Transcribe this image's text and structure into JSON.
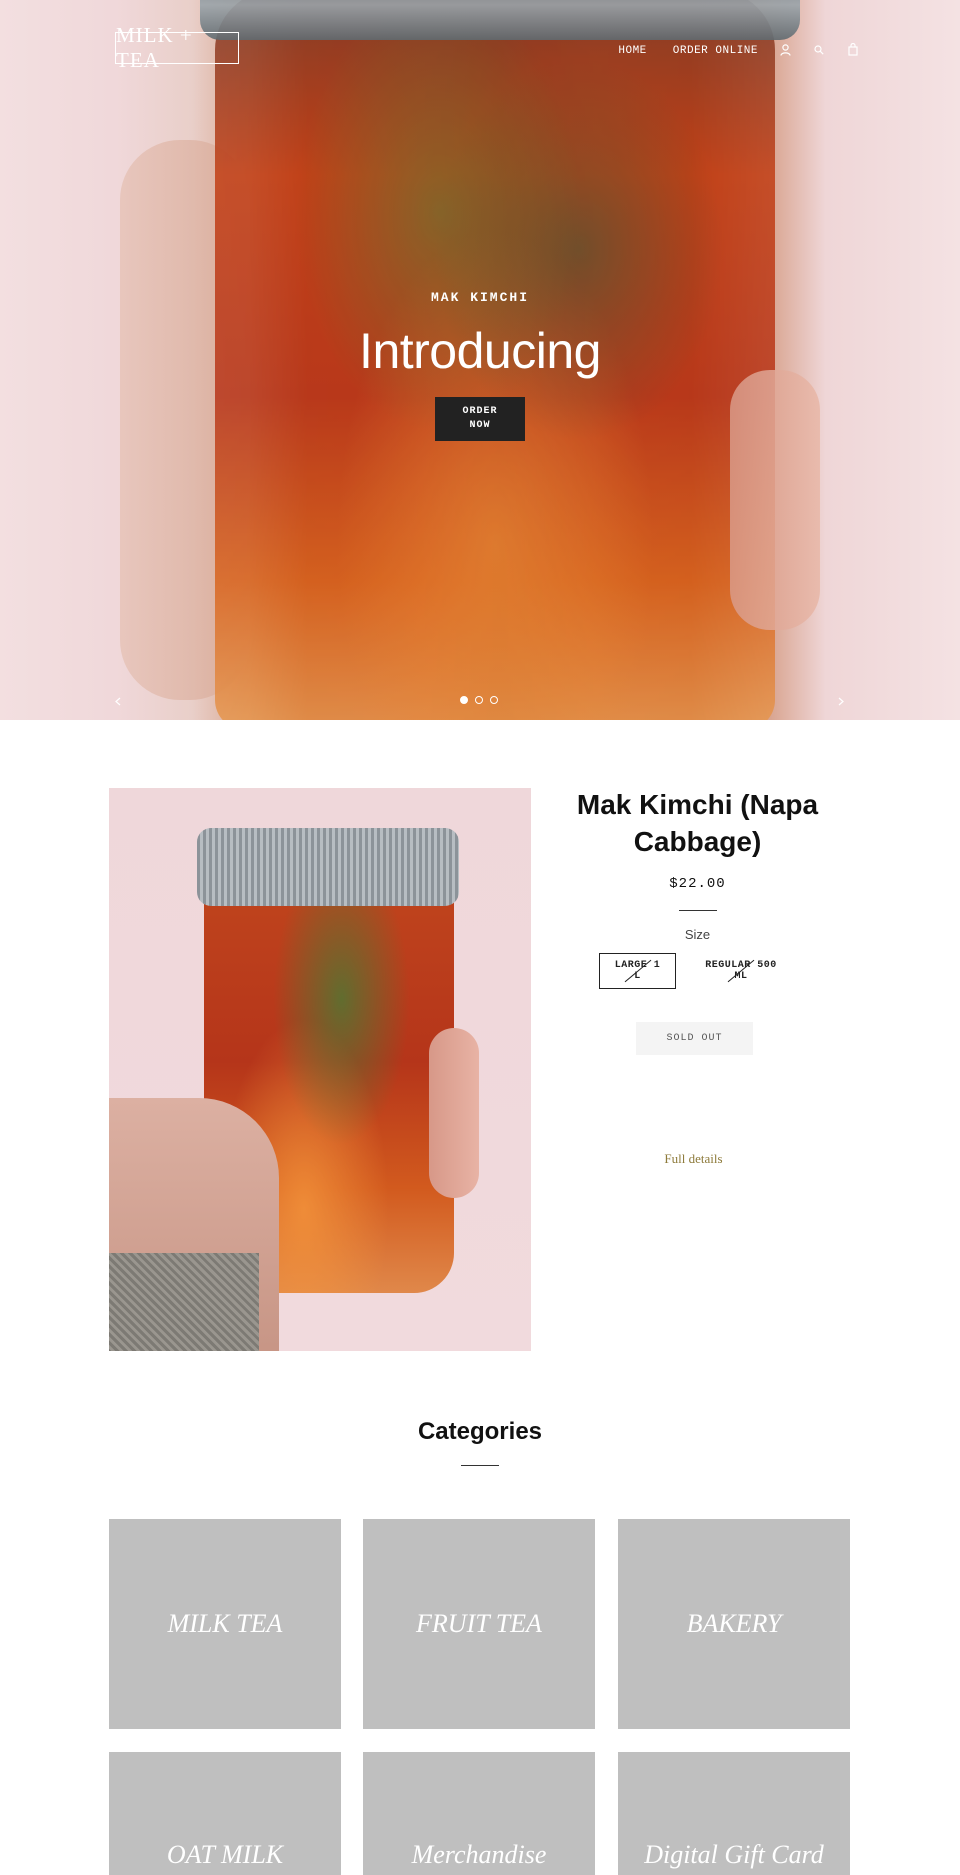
{
  "header": {
    "logo_text": "MILK + TEA",
    "nav": [
      {
        "label": "HOME"
      },
      {
        "label": "ORDER ONLINE"
      }
    ],
    "icons": [
      "user-icon",
      "search-icon",
      "cart-icon"
    ]
  },
  "hero": {
    "subtitle": "MAK KIMCHI",
    "title": "Introducing",
    "button_line1": "ORDER",
    "button_line2": "NOW",
    "slide_count": 3,
    "active_slide": 1
  },
  "product": {
    "title": "Mak Kimchi (Napa Cabbage)",
    "price": "$22.00",
    "size_label": "Size",
    "sizes": [
      {
        "label_line1": "LARGE 1",
        "label_line2": "L",
        "selected": true,
        "available": false
      },
      {
        "label_line1": "REGULAR 500",
        "label_line2": "ML",
        "selected": false,
        "available": false
      }
    ],
    "sold_out_label": "SOLD OUT",
    "full_details_label": "Full details"
  },
  "categories": {
    "title": "Categories",
    "items": [
      "MILK TEA",
      "FRUIT TEA",
      "BAKERY",
      "OAT MILK",
      "Merchandise",
      "Digital Gift Card"
    ]
  },
  "colors": {
    "button_dark": "#222222",
    "category_tile": "#bfbfbf",
    "link_gold": "#8d7a3a",
    "sold_out_bg": "#f4f4f4"
  }
}
